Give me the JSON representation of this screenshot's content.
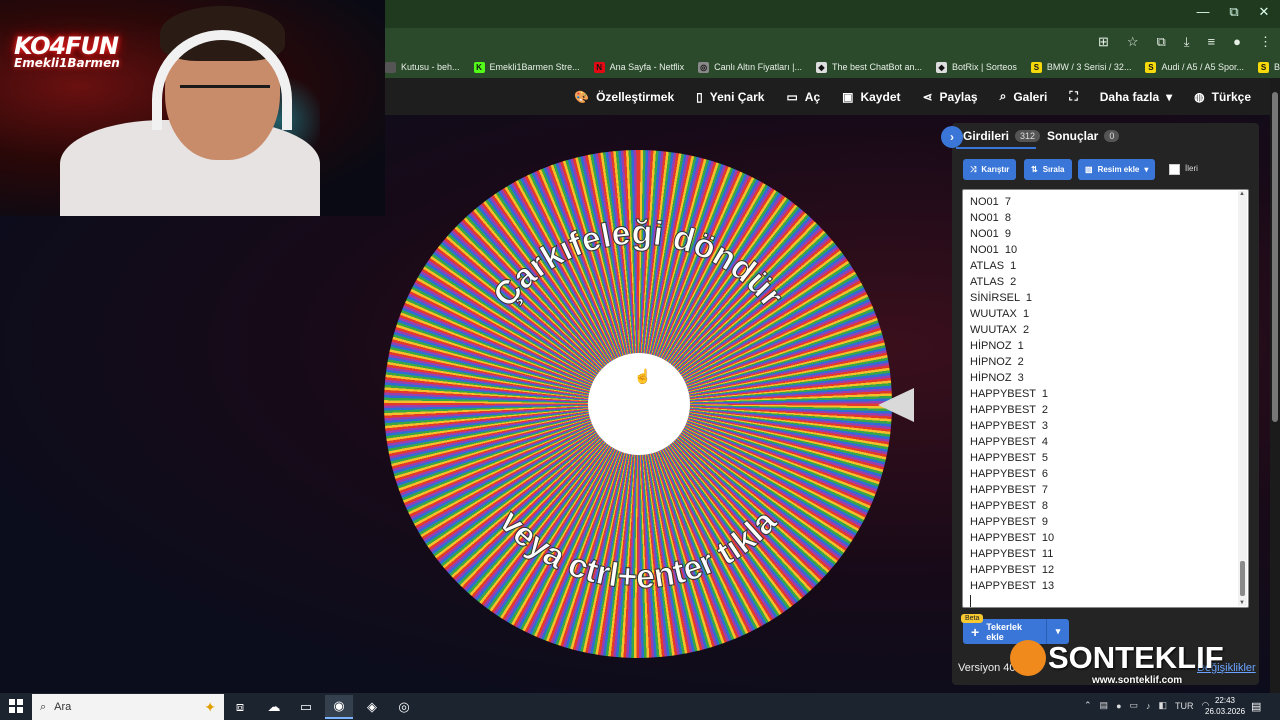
{
  "window": {
    "minimize": "—",
    "restore": "⧉",
    "close": "✕"
  },
  "bookmarks": [
    {
      "icon_text": "",
      "icon_color": "#555555",
      "label": "Kutusu - beh..."
    },
    {
      "icon_text": "K",
      "icon_color": "#53fc18",
      "label": "Emekli1Barmen Stre..."
    },
    {
      "icon_text": "N",
      "icon_color": "#e50914",
      "label": "Ana Sayfa - Netflix"
    },
    {
      "icon_text": "◎",
      "icon_color": "#888888",
      "label": "Canlı Altın Fiyatları |..."
    },
    {
      "icon_text": "◆",
      "icon_color": "#dddddd",
      "label": "The best ChatBot an..."
    },
    {
      "icon_text": "◆",
      "icon_color": "#dddddd",
      "label": "BotRix | Sorteos"
    },
    {
      "icon_text": "S",
      "icon_color": "#f5d90a",
      "label": "BMW / 3 Serisi / 32..."
    },
    {
      "icon_text": "S",
      "icon_color": "#f5d90a",
      "label": "Audi / A5 / A5 Spor..."
    },
    {
      "icon_text": "S",
      "icon_color": "#f5d90a",
      "label": "BMW / 3 Serisi / 32..."
    }
  ],
  "toolbar": {
    "customize": "Özelleştirmek",
    "new_wheel": "Yeni Çark",
    "open": "Aç",
    "save": "Kaydet",
    "share": "Paylaş",
    "gallery": "Galeri",
    "more": "Daha fazla",
    "language": "Türkçe"
  },
  "wheel": {
    "top_text": "Çarkıfeleği döndür",
    "bottom_text": "veya ctrl+enter tıkla"
  },
  "panel": {
    "tab_entries": "Girdileri",
    "entries_count": "312",
    "tab_results": "Sonuçlar",
    "results_count": "0",
    "shuffle": "Karıştır",
    "sort": "Sırala",
    "add_image": "Resim ekle",
    "advanced": "İleri",
    "entries": [
      "NO01  7",
      "NO01  8",
      "NO01  9",
      "NO01  10",
      "ATLAS  1",
      "ATLAS  2",
      "SİNİRSEL  1",
      "WUUTAX  1",
      "WUUTAX  2",
      "HİPNOZ  1",
      "HİPNOZ  2",
      "HİPNOZ  3",
      "HAPPYBEST  1",
      "HAPPYBEST  2",
      "HAPPYBEST  3",
      "HAPPYBEST  4",
      "HAPPYBEST  5",
      "HAPPYBEST  6",
      "HAPPYBEST  7",
      "HAPPYBEST  8",
      "HAPPYBEST  9",
      "HAPPYBEST  10",
      "HAPPYBEST  11",
      "HAPPYBEST  12",
      "HAPPYBEST  13"
    ],
    "beta": "Beta",
    "add_wheel": "Tekerlek ekle",
    "version": "Versiyon 405",
    "changes": "Değişiklikler"
  },
  "overlay": {
    "cam_logo_line1": "KO4FUN",
    "cam_logo_line2": "Emekli1Barmen",
    "brand": "SONTEKLIF",
    "brand_url": "www.sonteklif.com"
  },
  "taskbar": {
    "search_placeholder": "Ara",
    "language": "TUR",
    "time": "22:43",
    "date": "26.03.2026"
  },
  "colors": {
    "accent": "#3a76d8",
    "wheel_segments": [
      "#e53a2b",
      "#f6c12a",
      "#38a846",
      "#2f6fd6",
      "#9a3fb2"
    ]
  }
}
